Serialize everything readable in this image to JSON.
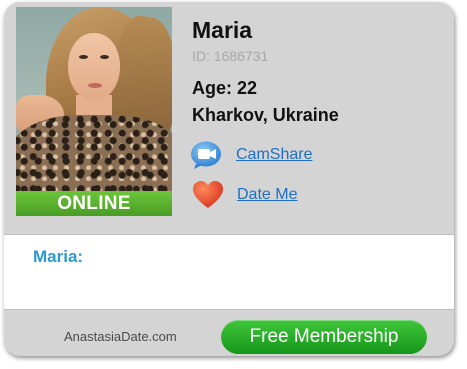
{
  "profile": {
    "name": "Maria",
    "id_text": "ID: 1686731",
    "age_text": "Age: 22",
    "location": "Kharkov, Ukraine",
    "status": "ONLINE"
  },
  "actions": {
    "camshare_label": "CamShare",
    "camshare_icon": "video-camera-icon",
    "dateme_label": "Date Me",
    "dateme_icon": "heart-icon"
  },
  "message": {
    "label": "Maria:"
  },
  "footer": {
    "brand": "AnastasiaDate.com",
    "cta_label": "Free Membership"
  },
  "colors": {
    "online_green": "#4a9d25",
    "link_blue": "#1f6fc4",
    "message_label_blue": "#2a9ad0",
    "cta_green": "#16961a",
    "heart_red": "#e8412a",
    "camera_blue": "#3b8fdc"
  }
}
